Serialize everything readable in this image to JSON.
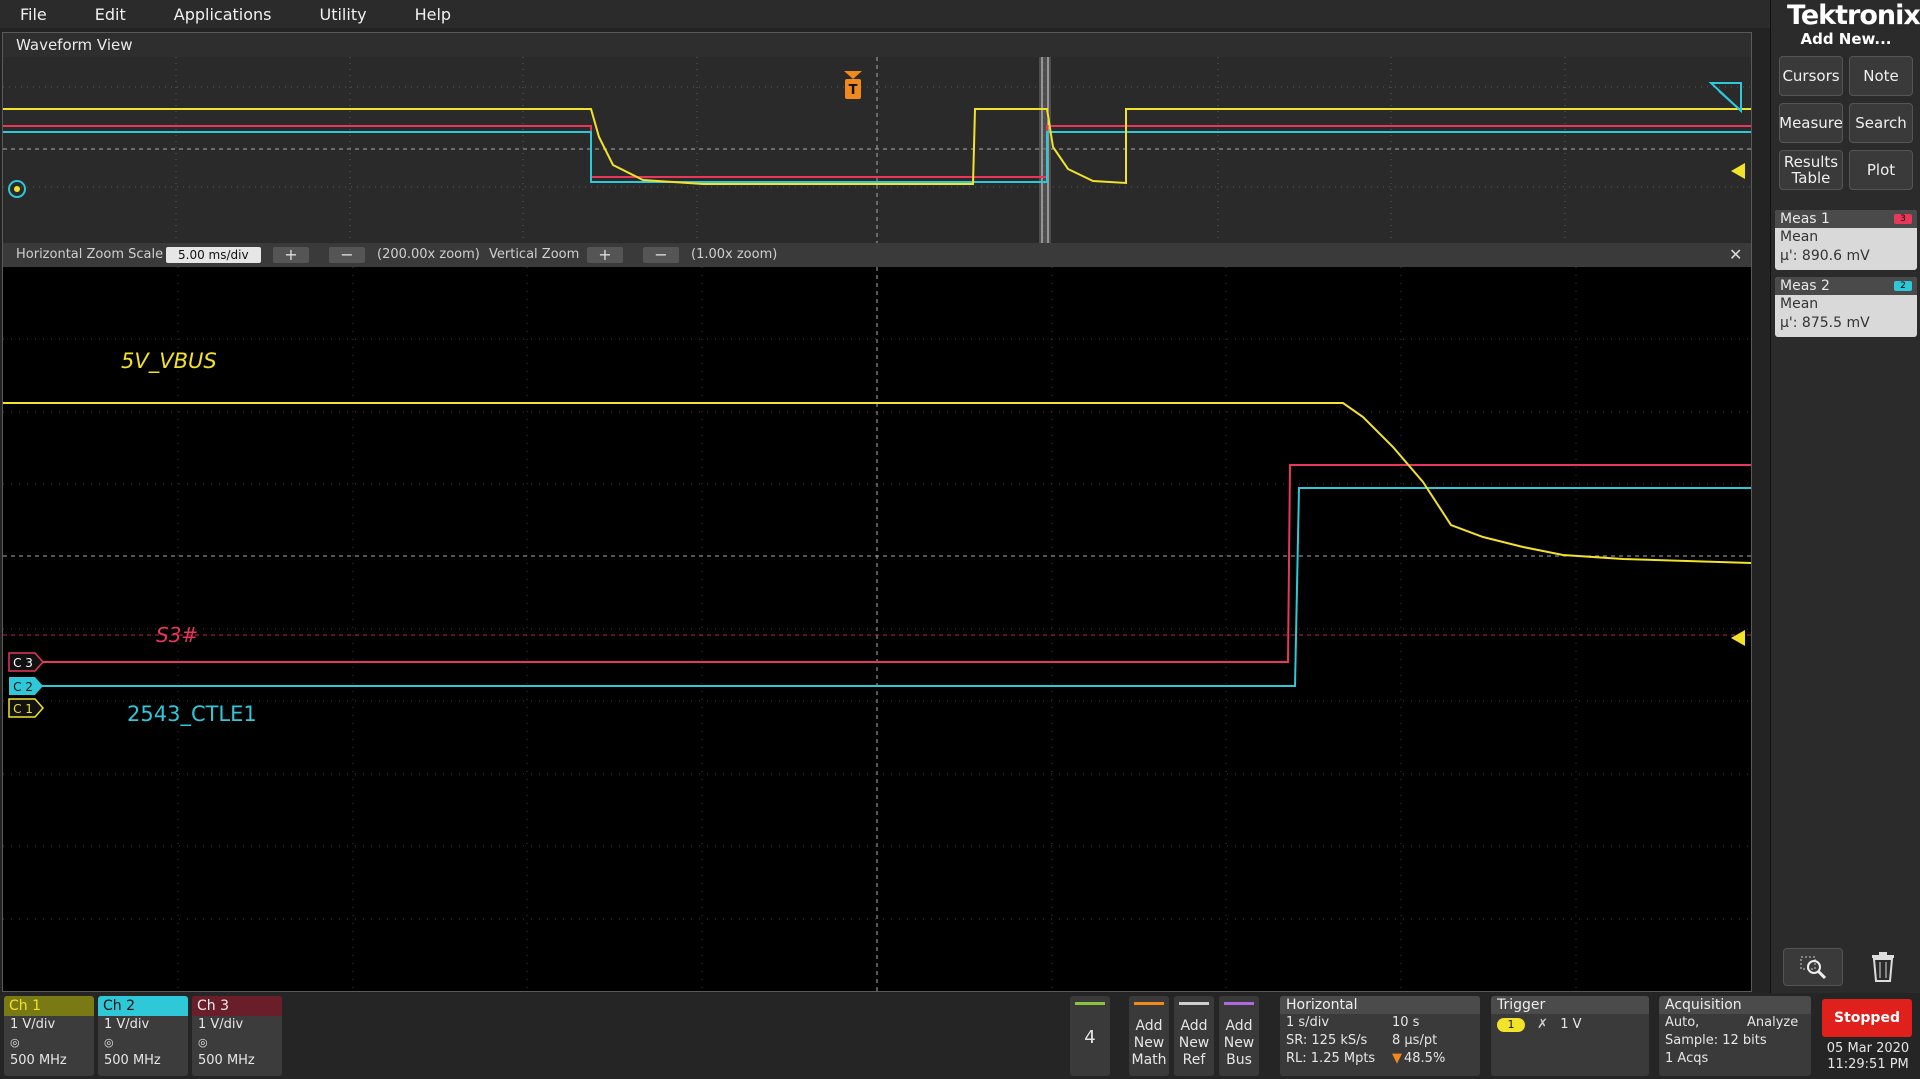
{
  "menu": [
    "File",
    "Edit",
    "Applications",
    "Utility",
    "Help"
  ],
  "brand": "Tektronix",
  "right_panel": {
    "add_new": "Add New...",
    "buttons": {
      "cursors": "Cursors",
      "note": "Note",
      "measure": "Measure",
      "search": "Search",
      "results_line1": "Results",
      "results_line2": "Table",
      "plot": "Plot"
    },
    "meas": [
      {
        "title": "Meas 1",
        "badge": "3",
        "type": "Mean",
        "value": "µ': 890.6 mV",
        "color": "#e8375a"
      },
      {
        "title": "Meas 2",
        "badge": "2",
        "type": "Mean",
        "value": "µ': 875.5 mV",
        "color": "#2ec8d8"
      }
    ],
    "icons": {
      "zoom": "zoom-icon",
      "trash": "trash-icon"
    }
  },
  "waveform_view": {
    "title": "Waveform View",
    "trigger_marker": "T",
    "zoom_bar": {
      "h_label": "Horizontal Zoom Scale",
      "h_scale": "5.00 ms/div",
      "h_zoom": "(200.00x zoom)",
      "v_label": "Vertical Zoom",
      "v_zoom": "(1.00x zoom)",
      "plus": "+",
      "minus": "−",
      "close": "✕"
    },
    "labels": {
      "vbus": "5V_VBUS",
      "s3": "S3#",
      "ctle": "2543_CTLE1"
    },
    "ch_markers": {
      "c3": "C 3",
      "c2": "C 2",
      "c1": "C 1"
    }
  },
  "colors": {
    "ch1": "#f2e22a",
    "ch2": "#2ec8d8",
    "ch3": "#e8375a",
    "grid": "#555555"
  },
  "channels": [
    {
      "title": "Ch 1",
      "scale": "1 V/div",
      "bw": "500 MHz",
      "color": "#f2e22a"
    },
    {
      "title": "Ch 2",
      "scale": "1 V/div",
      "bw": "500 MHz",
      "color": "#2ec8d8"
    },
    {
      "title": "Ch 3",
      "scale": "1 V/div",
      "bw": "500 MHz",
      "color": "#e8375a"
    }
  ],
  "bottom": {
    "count": "4",
    "add_math": [
      "Add",
      "New",
      "Math"
    ],
    "add_ref": [
      "Add",
      "New",
      "Ref"
    ],
    "add_bus": [
      "Add",
      "New",
      "Bus"
    ],
    "horizontal": {
      "title": "Horizontal",
      "scale": "1 s/div",
      "duration": "10 s",
      "sr": "SR: 125 kS/s",
      "pt": "8 µs/pt",
      "rl": "RL: 1.25 Mpts",
      "pos": "48.5%"
    },
    "trigger": {
      "title": "Trigger",
      "source": "1",
      "level": "1 V"
    },
    "acquisition": {
      "title": "Acquisition",
      "mode": "Auto,",
      "analyze": "Analyze",
      "sample": "Sample: 12 bits",
      "acqs": "1 Acqs"
    },
    "status": "Stopped",
    "date": "05 Mar 2020",
    "time": "11:29:51 PM"
  }
}
